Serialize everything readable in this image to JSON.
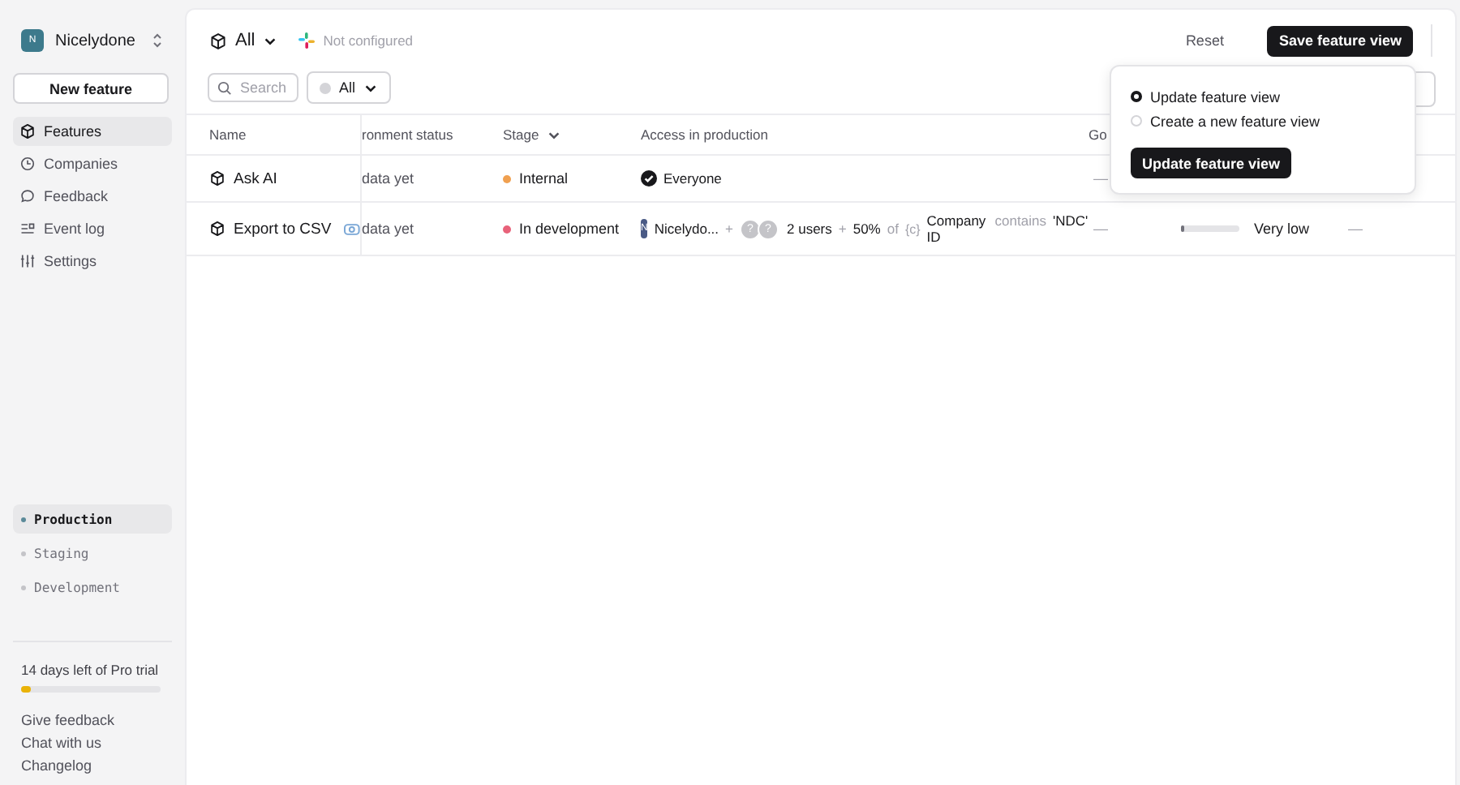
{
  "sidebar": {
    "org": {
      "initial": "N",
      "name": "Nicelydone"
    },
    "new_button": "New feature",
    "nav": [
      {
        "label": "Features",
        "selected": true
      },
      {
        "label": "Companies",
        "selected": false
      },
      {
        "label": "Feedback",
        "selected": false
      },
      {
        "label": "Event log",
        "selected": false
      },
      {
        "label": "Settings",
        "selected": false
      }
    ],
    "environments": [
      {
        "label": "Production",
        "selected": true
      },
      {
        "label": "Staging",
        "selected": false
      },
      {
        "label": "Development",
        "selected": false
      }
    ],
    "trial": {
      "text": "14 days left of Pro trial",
      "level": 0.07
    },
    "links": [
      "Give feedback",
      "Chat with us",
      "Changelog"
    ]
  },
  "toolbar": {
    "view": "All",
    "integration": "Not configured",
    "reset": "Reset",
    "save": "Save feature view"
  },
  "filters": {
    "search_placeholder": "Search",
    "status_filter": "All"
  },
  "popover": {
    "options": [
      {
        "label": "Update feature view",
        "selected": true
      },
      {
        "label": "Create a new feature view",
        "selected": false
      }
    ],
    "button": "Update feature view"
  },
  "table": {
    "columns": [
      "Name",
      "ronment status",
      "Stage",
      "Access in production",
      "Go"
    ],
    "rows": [
      {
        "name": "Ask AI",
        "synced": false,
        "env_status": "data yet",
        "stage": {
          "label": "Internal",
          "color": "#f0a050"
        },
        "access": {
          "kind": "everyone",
          "label": "Everyone"
        },
        "go": "—"
      },
      {
        "name": "Export to CSV",
        "synced": true,
        "env_status": "data yet",
        "stage": {
          "label": "In development",
          "color": "#e8627a"
        },
        "access": {
          "kind": "rules",
          "company": "N",
          "company_name": "Nicelydo...",
          "plus1": "+",
          "avatars": [
            "?",
            "?"
          ],
          "users": "2 users",
          "plus2": "+",
          "percent": "50%",
          "of": "of",
          "attr_icon": "{c}",
          "attribute": "Company ID",
          "operator": "contains",
          "value": "'NDC'"
        },
        "go": "—",
        "impact": {
          "level": 0.06,
          "label": "Very low"
        },
        "last": "—"
      }
    ]
  }
}
